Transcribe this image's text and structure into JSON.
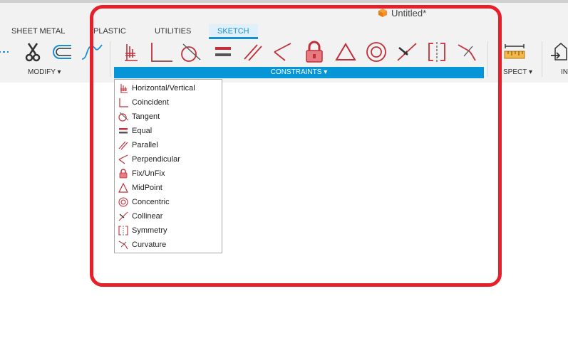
{
  "document": {
    "title": "Untitled*"
  },
  "tabs": [
    {
      "label": "SHEET METAL"
    },
    {
      "label": "PLASTIC"
    },
    {
      "label": "UTILITIES"
    },
    {
      "label": "SKETCH"
    }
  ],
  "groups": {
    "modify": "MODIFY ▾",
    "constraints": "CONSTRAINTS ▾",
    "inspect": "SPECT ▾",
    "insert": "IN"
  },
  "constraints_menu": {
    "items": [
      {
        "label": "Horizontal/Vertical",
        "icon": "horizontal-vertical-icon"
      },
      {
        "label": "Coincident",
        "icon": "coincident-icon"
      },
      {
        "label": "Tangent",
        "icon": "tangent-icon"
      },
      {
        "label": "Equal",
        "icon": "equal-icon"
      },
      {
        "label": "Parallel",
        "icon": "parallel-icon"
      },
      {
        "label": "Perpendicular",
        "icon": "perpendicular-icon"
      },
      {
        "label": "Fix/UnFix",
        "icon": "lock-icon"
      },
      {
        "label": "MidPoint",
        "icon": "midpoint-icon"
      },
      {
        "label": "Concentric",
        "icon": "concentric-icon"
      },
      {
        "label": "Collinear",
        "icon": "collinear-icon"
      },
      {
        "label": "Symmetry",
        "icon": "symmetry-icon"
      },
      {
        "label": "Curvature",
        "icon": "curvature-icon"
      }
    ]
  },
  "colors": {
    "accent": "#0696d7",
    "constraint_red": "#c0303a",
    "highlight": "#e5202a"
  }
}
